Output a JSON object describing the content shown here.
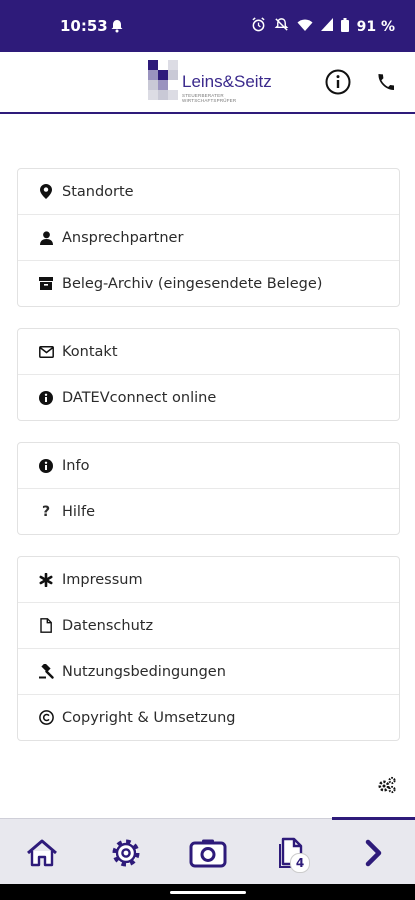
{
  "status": {
    "time": "10:53",
    "battery": "91 %"
  },
  "brand": {
    "name": "Leins&Seitz",
    "tagline": "STEUERBERATER WIRTSCHAFTSPRÜFER"
  },
  "groups": [
    {
      "items": [
        {
          "icon": "map-marker-icon",
          "label": "Standorte"
        },
        {
          "icon": "person-icon",
          "label": "Ansprechpartner"
        },
        {
          "icon": "archive-icon",
          "label": "Beleg-Archiv (eingesendete Belege)"
        }
      ]
    },
    {
      "items": [
        {
          "icon": "envelope-icon",
          "label": "Kontakt"
        },
        {
          "icon": "info-circle-icon",
          "label": "DATEVconnect online"
        }
      ]
    },
    {
      "items": [
        {
          "icon": "info-circle-icon",
          "label": "Info"
        },
        {
          "icon": "question-icon",
          "label": "Hilfe"
        }
      ]
    },
    {
      "items": [
        {
          "icon": "asterisk-icon",
          "label": "Impressum"
        },
        {
          "icon": "document-icon",
          "label": "Datenschutz"
        },
        {
          "icon": "gavel-icon",
          "label": "Nutzungsbedingungen"
        },
        {
          "icon": "copyright-icon",
          "label": "Copyright & Umsetzung"
        }
      ]
    }
  ],
  "nav": {
    "documents_badge": "4"
  },
  "colors": {
    "primary": "#2e1b7a",
    "nav_bg": "#e8e8ee"
  }
}
